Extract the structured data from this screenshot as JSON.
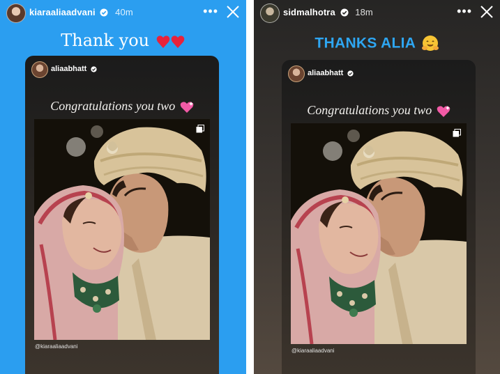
{
  "stories": [
    {
      "username": "kiaraaliaadvani",
      "time_ago": "40m",
      "caption": "Thank you",
      "caption_emoji": "two-red-hearts",
      "caption_color": "#ffffff",
      "background": "#2b9ef0",
      "repost": {
        "username": "aliaabhatt",
        "text": "Congratulations you two",
        "emoji": "sparkling-heart",
        "tag": "@kiaraaliaadvani"
      }
    },
    {
      "username": "sidmalhotra",
      "time_ago": "18m",
      "caption": "THANKS ALIA",
      "caption_emoji": "hugging-face",
      "caption_color": "#2ea6f2",
      "background": "#3a3531",
      "repost": {
        "username": "aliaabhatt",
        "text": "Congratulations you two",
        "emoji": "sparkling-heart",
        "tag": "@kiaraaliaadvani"
      }
    }
  ],
  "icons": {
    "more": "more-horizontal-icon",
    "close": "close-icon",
    "verified": "verified-badge-icon",
    "multi_photo": "multi-photo-icon"
  },
  "photo": {
    "subject": "wedding-couple-photo"
  }
}
